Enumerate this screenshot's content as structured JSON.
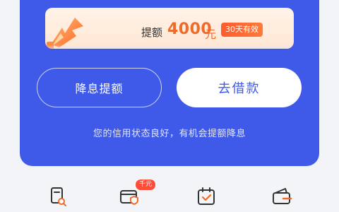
{
  "promo": {
    "label": "提额",
    "amount": "4000",
    "unit": "元",
    "badge": "30天有效"
  },
  "actions": {
    "reduce_interest_label": "降息提额",
    "borrow_label": "去借款"
  },
  "hint": "您的信用状态良好，有机会提额降息",
  "quick_menu": {
    "items": [
      {
        "icon": "bill-search-icon"
      },
      {
        "icon": "card-shield-icon",
        "badge": "千元"
      },
      {
        "icon": "calendar-check-icon"
      },
      {
        "icon": "wallet-icon"
      }
    ]
  },
  "colors": {
    "primary_blue": "#3f5ae8",
    "accent_orange": "#f06a2a",
    "badge_red": "#ff4d3a",
    "background": "#f3f4f8"
  }
}
